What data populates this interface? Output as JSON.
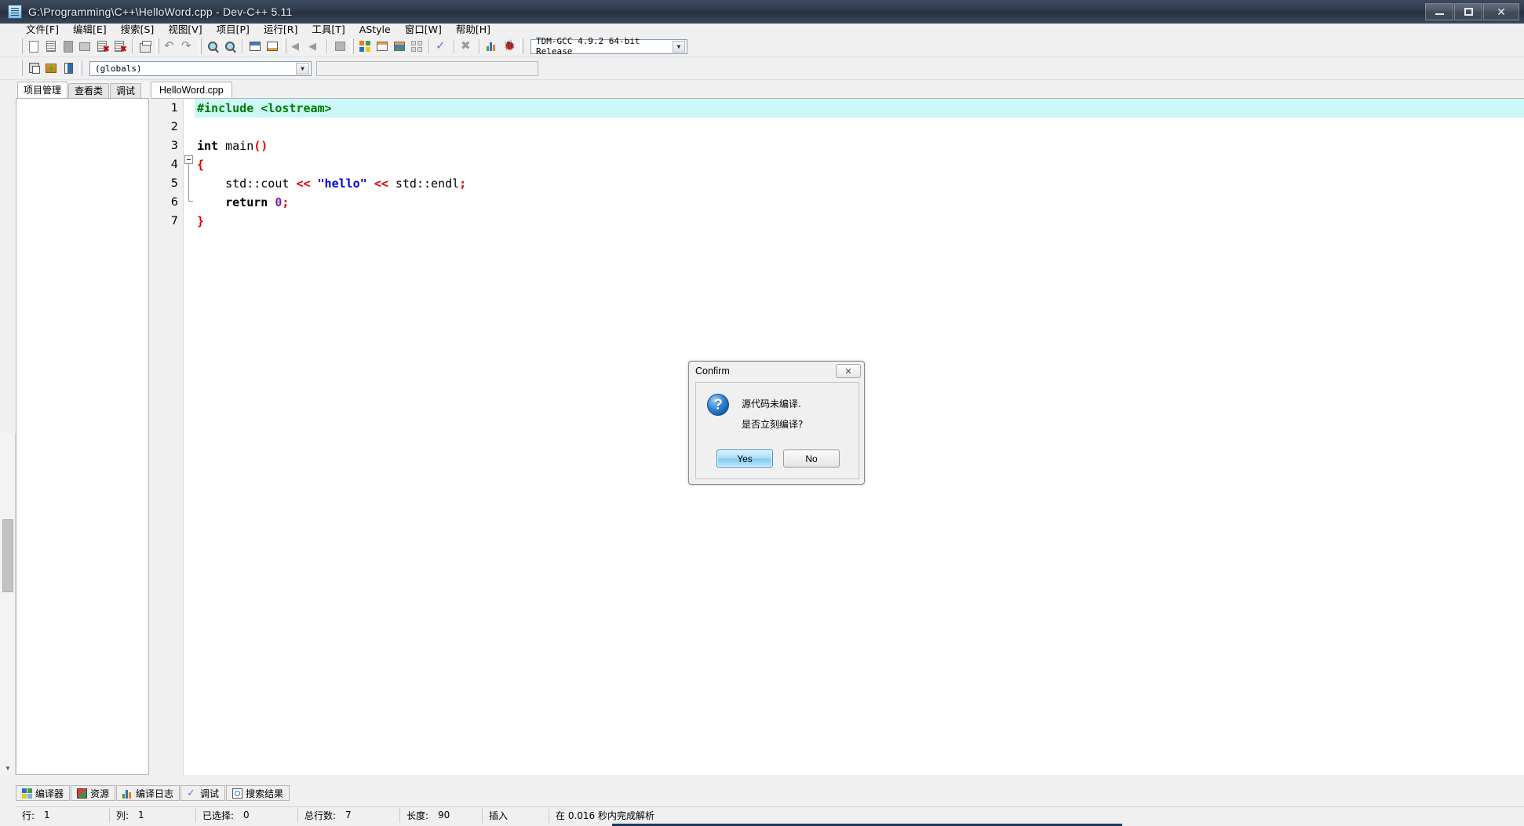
{
  "window": {
    "title": "G:\\Programming\\C++\\HelloWord.cpp - Dev-C++ 5.11",
    "app_icon": "devcpp-app-icon",
    "buttons": {
      "minimize": "minimize-button",
      "maximize": "maximize-button",
      "close": "close-button"
    }
  },
  "menubar": {
    "items": [
      {
        "label": "文件[F]",
        "name": "menu-file"
      },
      {
        "label": "编辑[E]",
        "name": "menu-edit"
      },
      {
        "label": "搜索[S]",
        "name": "menu-search"
      },
      {
        "label": "视图[V]",
        "name": "menu-view"
      },
      {
        "label": "项目[P]",
        "name": "menu-project"
      },
      {
        "label": "运行[R]",
        "name": "menu-run"
      },
      {
        "label": "工具[T]",
        "name": "menu-tools"
      },
      {
        "label": "AStyle",
        "name": "menu-astyle"
      },
      {
        "label": "窗口[W]",
        "name": "menu-window"
      },
      {
        "label": "帮助[H]",
        "name": "menu-help"
      }
    ]
  },
  "toolbar": {
    "compiler_combo": {
      "value": "TDM-GCC 4.9.2 64-bit Release",
      "caret": "▼"
    },
    "globals_combo": {
      "value": "(globals)",
      "caret": "▼"
    },
    "blank_combo": {
      "value": "",
      "caret": "▼"
    }
  },
  "left_panel": {
    "tabs": [
      {
        "label": "项目管理",
        "name": "tab-project-manager",
        "active": true
      },
      {
        "label": "查看类",
        "name": "tab-class-browser",
        "active": false
      },
      {
        "label": "调试",
        "name": "tab-debug",
        "active": false
      }
    ]
  },
  "editor": {
    "file_tabs": [
      {
        "label": "HelloWord.cpp",
        "name": "file-tab-helloword",
        "active": true
      }
    ],
    "line_numbers": [
      "1",
      "2",
      "3",
      "4",
      "5",
      "6",
      "7"
    ],
    "lines": [
      {
        "n": 1,
        "highlighted": true,
        "tokens": [
          {
            "t": "#include ",
            "c": "pre"
          },
          {
            "t": "<lostream>",
            "c": "pre"
          }
        ]
      },
      {
        "n": 2,
        "highlighted": false,
        "tokens": []
      },
      {
        "n": 3,
        "highlighted": false,
        "tokens": [
          {
            "t": "int",
            "c": "kw"
          },
          {
            "t": " main",
            "c": "id"
          },
          {
            "t": "()",
            "c": "brace"
          }
        ]
      },
      {
        "n": 4,
        "highlighted": false,
        "tokens": [
          {
            "t": "{",
            "c": "brace"
          }
        ]
      },
      {
        "n": 5,
        "highlighted": false,
        "tokens": [
          {
            "t": "    std::cout ",
            "c": "id"
          },
          {
            "t": "<<",
            "c": "op"
          },
          {
            "t": " ",
            "c": "id"
          },
          {
            "t": "\"hello\"",
            "c": "str"
          },
          {
            "t": " ",
            "c": "id"
          },
          {
            "t": "<<",
            "c": "op"
          },
          {
            "t": " std::endl",
            "c": "id"
          },
          {
            "t": ";",
            "c": "op"
          }
        ]
      },
      {
        "n": 6,
        "highlighted": false,
        "tokens": [
          {
            "t": "    return ",
            "c": "kw"
          },
          {
            "t": "0",
            "c": "num"
          },
          {
            "t": ";",
            "c": "op"
          }
        ]
      },
      {
        "n": 7,
        "highlighted": false,
        "tokens": [
          {
            "t": "}",
            "c": "brace"
          }
        ]
      }
    ]
  },
  "bottom_tabs": [
    {
      "label": "编译器",
      "name": "bottom-tab-compiler"
    },
    {
      "label": "资源",
      "name": "bottom-tab-resources"
    },
    {
      "label": "编译日志",
      "name": "bottom-tab-compile-log"
    },
    {
      "label": "调试",
      "name": "bottom-tab-debug"
    },
    {
      "label": "搜索结果",
      "name": "bottom-tab-search-results"
    }
  ],
  "statusbar": {
    "row_label": "行:",
    "row_value": "1",
    "col_label": "列:",
    "col_value": "1",
    "sel_label": "已选择:",
    "sel_value": "0",
    "total_label": "总行数:",
    "total_value": "7",
    "len_label": "长度:",
    "len_value": "90",
    "mode": "插入",
    "parse_message": "在 0.016 秒内完成解析"
  },
  "dialog": {
    "title": "Confirm",
    "close_glyph": "✕",
    "icon": "question-icon",
    "icon_glyph": "?",
    "message_line1": "源代码未编译.",
    "message_line2": "是否立刻编译?",
    "yes_label": "Yes",
    "no_label": "No"
  },
  "colors": {
    "titlebar": "#2f3b4c",
    "accent": "#3c8ccd",
    "highlight_line": "#ccf8f8",
    "preprocessor": "#007c00",
    "string": "#0000e0",
    "operator": "#e00000",
    "number": "#7a1fa2"
  }
}
